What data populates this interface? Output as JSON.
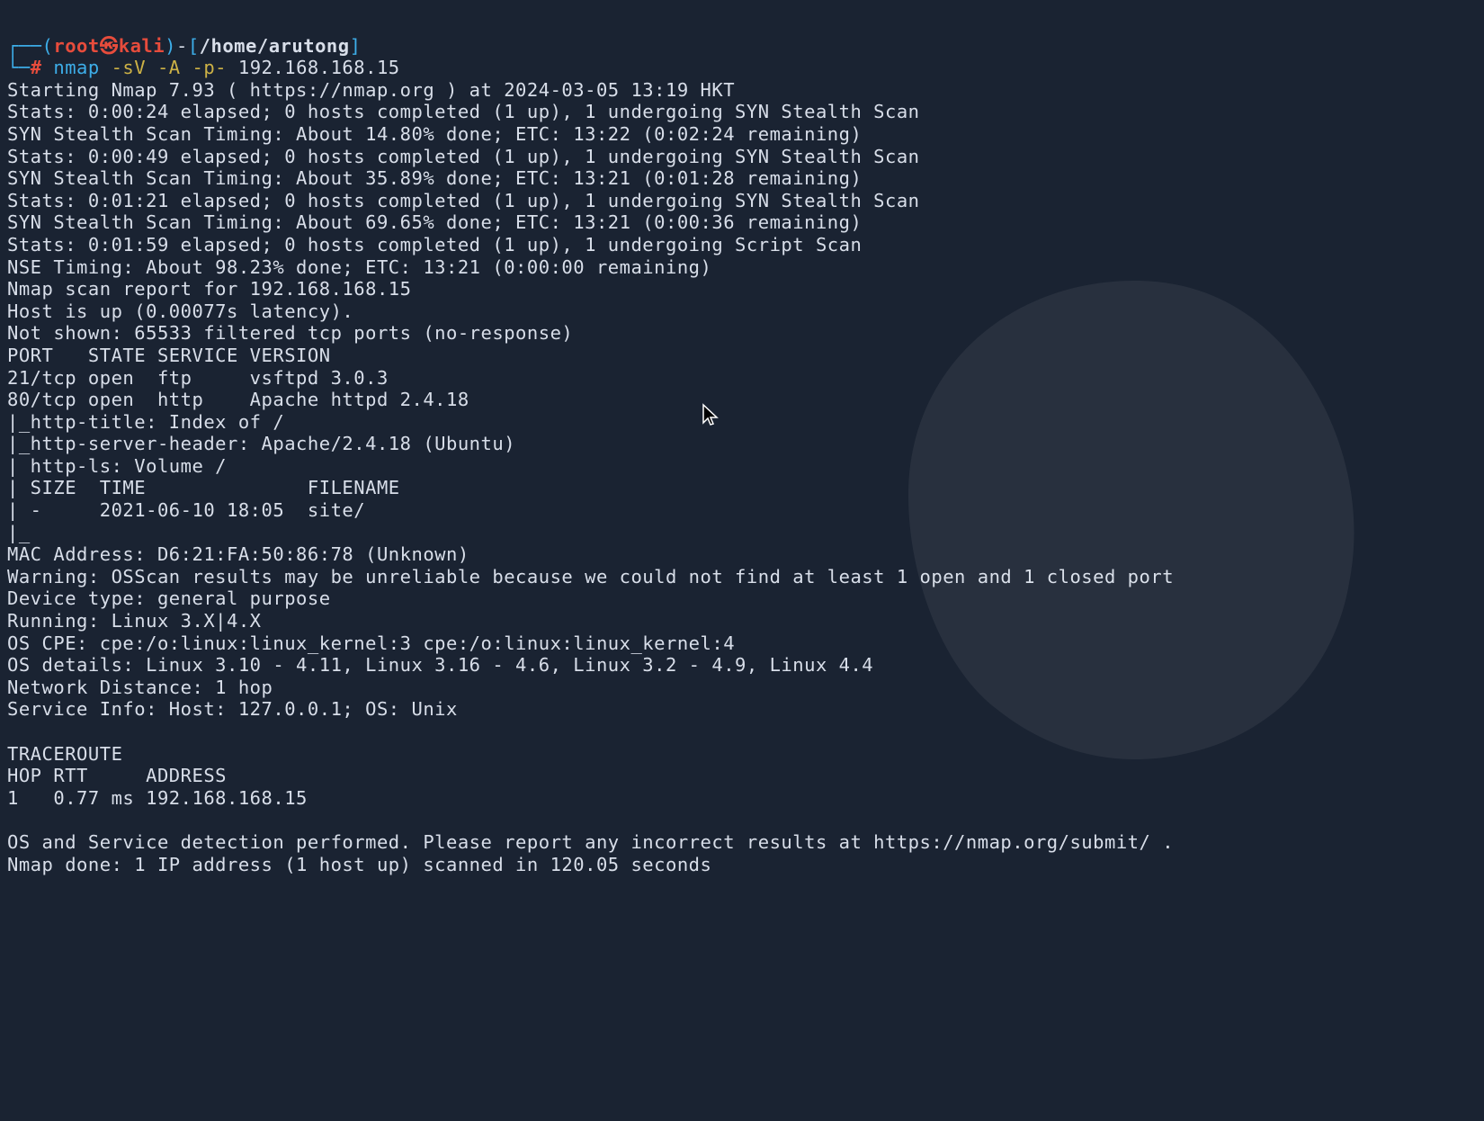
{
  "prompt": {
    "corner_top": "┌──",
    "paren_open": "(",
    "user": "root",
    "skull": "㉿",
    "host": "kali",
    "paren_close": ")",
    "dash": "-",
    "bracket_open": "[",
    "cwd": "/home/arutong",
    "bracket_close": "]",
    "corner_bottom": "└─",
    "hash": "#",
    "command": "nmap ",
    "flags": "-sV -A -p-",
    "arg": " 192.168.168.15"
  },
  "output": {
    "l01": "Starting Nmap 7.93 ( https://nmap.org ) at 2024-03-05 13:19 HKT",
    "l02": "Stats: 0:00:24 elapsed; 0 hosts completed (1 up), 1 undergoing SYN Stealth Scan",
    "l03": "SYN Stealth Scan Timing: About 14.80% done; ETC: 13:22 (0:02:24 remaining)",
    "l04": "Stats: 0:00:49 elapsed; 0 hosts completed (1 up), 1 undergoing SYN Stealth Scan",
    "l05": "SYN Stealth Scan Timing: About 35.89% done; ETC: 13:21 (0:01:28 remaining)",
    "l06": "Stats: 0:01:21 elapsed; 0 hosts completed (1 up), 1 undergoing SYN Stealth Scan",
    "l07": "SYN Stealth Scan Timing: About 69.65% done; ETC: 13:21 (0:00:36 remaining)",
    "l08": "Stats: 0:01:59 elapsed; 0 hosts completed (1 up), 1 undergoing Script Scan",
    "l09": "NSE Timing: About 98.23% done; ETC: 13:21 (0:00:00 remaining)",
    "l10": "Nmap scan report for 192.168.168.15",
    "l11": "Host is up (0.00077s latency).",
    "l12": "Not shown: 65533 filtered tcp ports (no-response)",
    "l13": "PORT   STATE SERVICE VERSION",
    "l14": "21/tcp open  ftp     vsftpd 3.0.3",
    "l15": "80/tcp open  http    Apache httpd 2.4.18",
    "l16": "|_http-title: Index of /",
    "l17": "|_http-server-header: Apache/2.4.18 (Ubuntu)",
    "l18": "| http-ls: Volume /",
    "l19": "| SIZE  TIME              FILENAME",
    "l20": "| -     2021-06-10 18:05  site/",
    "l21": "|_",
    "l22": "MAC Address: D6:21:FA:50:86:78 (Unknown)",
    "l23": "Warning: OSScan results may be unreliable because we could not find at least 1 open and 1 closed port",
    "l24": "Device type: general purpose",
    "l25": "Running: Linux 3.X|4.X",
    "l26": "OS CPE: cpe:/o:linux:linux_kernel:3 cpe:/o:linux:linux_kernel:4",
    "l27": "OS details: Linux 3.10 - 4.11, Linux 3.16 - 4.6, Linux 3.2 - 4.9, Linux 4.4",
    "l28": "Network Distance: 1 hop",
    "l29": "Service Info: Host: 127.0.0.1; OS: Unix",
    "l30": "",
    "l31": "TRACEROUTE",
    "l32": "HOP RTT     ADDRESS",
    "l33": "1   0.77 ms 192.168.168.15",
    "l34": "",
    "l35": "OS and Service detection performed. Please report any incorrect results at https://nmap.org/submit/ .",
    "l36": "Nmap done: 1 IP address (1 host up) scanned in 120.05 seconds"
  }
}
